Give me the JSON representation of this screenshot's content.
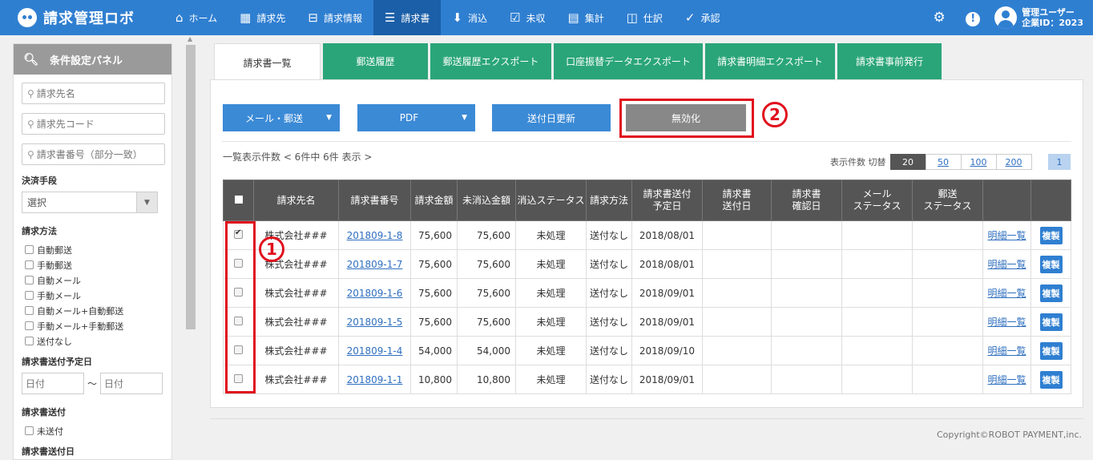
{
  "brand": {
    "name": "請求管理ロボ"
  },
  "nav": [
    {
      "icon": "home-icon",
      "glyph": "⌂",
      "label": "ホーム"
    },
    {
      "icon": "building-icon",
      "glyph": "▦",
      "label": "請求先"
    },
    {
      "icon": "tray-icon",
      "glyph": "⊟",
      "label": "請求情報"
    },
    {
      "icon": "invoice-list-icon",
      "glyph": "☰",
      "label": "請求書",
      "active": true
    },
    {
      "icon": "download-icon",
      "glyph": "⬇",
      "label": "消込"
    },
    {
      "icon": "checkbox-icon",
      "glyph": "☑",
      "label": "未収"
    },
    {
      "icon": "calculator-icon",
      "glyph": "▤",
      "label": "集計"
    },
    {
      "icon": "columns-icon",
      "glyph": "◫",
      "label": "仕訳"
    },
    {
      "icon": "check-circle-icon",
      "glyph": "✓",
      "label": "承認"
    }
  ],
  "user": {
    "name": "管理ユーザー",
    "company": "企業ID：2023"
  },
  "sidebar": {
    "title": "条件設定パネル",
    "inputs": [
      "請求先名",
      "請求先コード",
      "請求書番号（部分一致）"
    ],
    "payment_label": "決済手段",
    "payment_selected": "選択",
    "method_label": "請求方法",
    "methods": [
      "自動郵送",
      "手動郵送",
      "自動メール",
      "手動メール",
      "自動メール+自動郵送",
      "手動メール+手動郵送",
      "送付なし"
    ],
    "sched_label": "請求書送付予定日",
    "date_from_placeholder": "日付",
    "date_to_placeholder": "日付",
    "tilde": "〜",
    "sent_label": "請求書送付",
    "sent_option": "未送付",
    "sent_date_label": "請求書送付日"
  },
  "tabs": [
    "請求書一覧",
    "郵送履歴",
    "郵送履歴エクスポート",
    "口座振替データエクスポート",
    "請求書明細エクスポート",
    "請求書事前発行"
  ],
  "toolbar": {
    "mail": "メール・郵送",
    "pdf": "PDF",
    "update": "送付日更新",
    "invalidate": "無効化"
  },
  "annotations": {
    "one": "1",
    "two": "2"
  },
  "list": {
    "count_text": "一覧表示件数 < 6件中 6件 表示 >",
    "per_page_label": "表示件数 切替",
    "per_page_options": [
      "20",
      "50",
      "100",
      "200"
    ],
    "current_page": "1"
  },
  "table": {
    "headers": [
      "請求先名",
      "請求書番号",
      "請求金額",
      "未消込金額",
      "消込ステータス",
      "請求方法",
      "請求書送付\n予定日",
      "請求書\n送付日",
      "請求書\n確認日",
      "メール\nステータス",
      "郵送\nステータス"
    ],
    "rows": [
      {
        "checked": true,
        "client": "株式会社###",
        "no": "201809-1-8",
        "amount": "75,600",
        "unpaid": "75,600",
        "status": "未処理",
        "method": "送付なし",
        "scheduled": "2018/08/01",
        "detail": "明細一覧",
        "dup": "複製"
      },
      {
        "checked": false,
        "client": "株式会社###",
        "no": "201809-1-7",
        "amount": "75,600",
        "unpaid": "75,600",
        "status": "未処理",
        "method": "送付なし",
        "scheduled": "2018/08/01",
        "detail": "明細一覧",
        "dup": "複製"
      },
      {
        "checked": false,
        "client": "株式会社###",
        "no": "201809-1-6",
        "amount": "75,600",
        "unpaid": "75,600",
        "status": "未処理",
        "method": "送付なし",
        "scheduled": "2018/09/01",
        "detail": "明細一覧",
        "dup": "複製"
      },
      {
        "checked": false,
        "client": "株式会社###",
        "no": "201809-1-5",
        "amount": "75,600",
        "unpaid": "75,600",
        "status": "未処理",
        "method": "送付なし",
        "scheduled": "2018/09/01",
        "detail": "明細一覧",
        "dup": "複製"
      },
      {
        "checked": false,
        "client": "株式会社###",
        "no": "201809-1-4",
        "amount": "54,000",
        "unpaid": "54,000",
        "status": "未処理",
        "method": "送付なし",
        "scheduled": "2018/09/10",
        "detail": "明細一覧",
        "dup": "複製"
      },
      {
        "checked": false,
        "client": "株式会社###",
        "no": "201809-1-1",
        "amount": "10,800",
        "unpaid": "10,800",
        "status": "未処理",
        "method": "送付なし",
        "scheduled": "2018/09/01",
        "detail": "明細一覧",
        "dup": "複製"
      }
    ]
  },
  "footer": {
    "copyright": "Copyright©ROBOT PAYMENT,inc."
  },
  "colors": {
    "nav": "#2f7fd1",
    "tab": "#2aa57a",
    "highlight": "#e0101d"
  }
}
